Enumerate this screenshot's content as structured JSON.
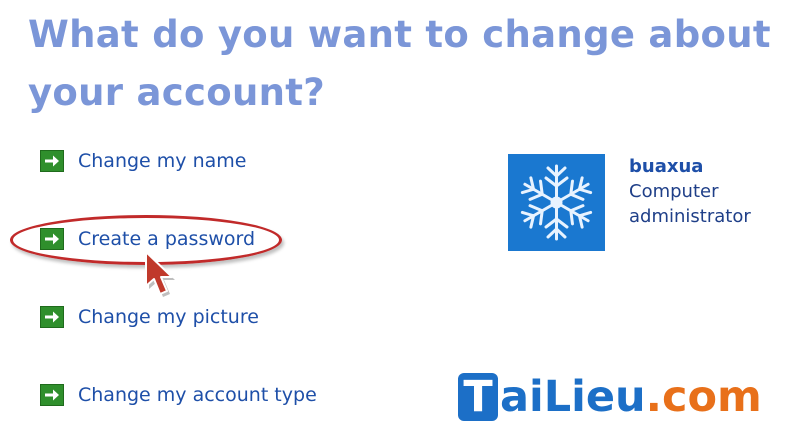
{
  "heading": {
    "line1": "What do you want to change about",
    "line2": "your account?"
  },
  "tasks": [
    {
      "label": "Change my name",
      "icon": "green-arrow-icon"
    },
    {
      "label": "Create a password",
      "icon": "green-arrow-icon",
      "highlighted": true
    },
    {
      "label": "Change my picture",
      "icon": "green-arrow-icon"
    },
    {
      "label": "Change my account type",
      "icon": "green-arrow-icon"
    }
  ],
  "account": {
    "name": "buaxua",
    "type_line1": "Computer",
    "type_line2": "administrator",
    "picture": "snowflake-picture"
  },
  "watermark": {
    "logo_letter": "T",
    "middle": "aiLieu",
    "suffix": ".com"
  },
  "colors": {
    "heading": "#7b96d8",
    "link": "#1e4fa8",
    "arrow_box": "#2f8f2c",
    "highlight_ring": "#c12a2a",
    "picture_bg": "#1a78d0",
    "watermark_blue": "#1c6fc7",
    "watermark_orange": "#e8701a"
  }
}
